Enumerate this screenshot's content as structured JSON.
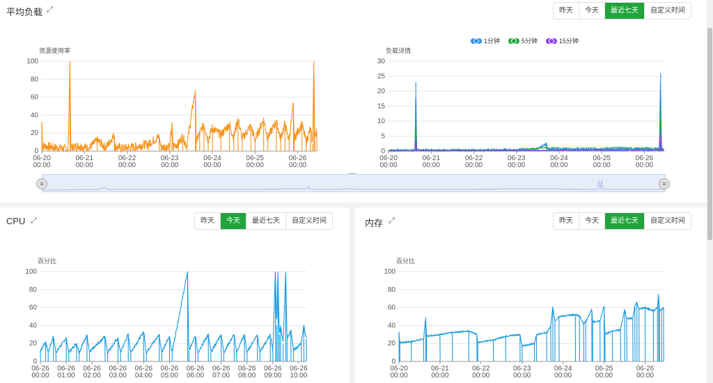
{
  "colors": {
    "active": "#20a53a",
    "load_resource": "#f7941d",
    "load_1min": "#2f8ee6",
    "load_5min": "#1ea83c",
    "load_15min": "#8a3ff0",
    "cpu": "#1a9be0",
    "memory": "#1a9be0",
    "grid": "#e6e6e6",
    "axis": "#999999"
  },
  "load_panel": {
    "title": "平均负载",
    "expand_icon": "expand-icon",
    "buttons": [
      "昨天",
      "今天",
      "最近七天",
      "自定义时间"
    ],
    "active_button": "最近七天"
  },
  "cpu_panel": {
    "title": "CPU",
    "expand_icon": "expand-icon",
    "buttons": [
      "昨天",
      "今天",
      "最近七天",
      "自定义时间"
    ],
    "active_button": "今天"
  },
  "memory_panel": {
    "title": "内存",
    "expand_icon": "expand-icon",
    "buttons": [
      "昨天",
      "今天",
      "最近七天",
      "自定义时间"
    ],
    "active_button": "最近七天"
  },
  "chart_data": [
    {
      "id": "load-usage",
      "type": "line",
      "ylabel": "资源使用率",
      "ylim": [
        0,
        100
      ],
      "yticks": [
        0,
        20,
        40,
        60,
        80,
        100
      ],
      "xticks": [
        "06-20 00:00",
        "06-21 00:00",
        "06-22 00:00",
        "06-23 00:00",
        "06-24 00:00",
        "06-25 00:00",
        "06-26 00:00"
      ],
      "x_range_days": [
        0,
        6.45
      ],
      "series": [
        {
          "points": [
            [
              0,
              33
            ],
            [
              0.02,
              6
            ],
            [
              0.3,
              4
            ],
            [
              0.5,
              3
            ],
            [
              0.62,
              2
            ],
            [
              0.66,
              100
            ],
            [
              0.68,
              4
            ],
            [
              0.9,
              6
            ],
            [
              1.1,
              3
            ],
            [
              1.3,
              12
            ],
            [
              1.5,
              4
            ],
            [
              1.7,
              18
            ],
            [
              1.72,
              5
            ],
            [
              1.9,
              3
            ],
            [
              2.2,
              5
            ],
            [
              2.5,
              8
            ],
            [
              2.75,
              16
            ],
            [
              2.8,
              4
            ],
            [
              3.0,
              6
            ],
            [
              3.05,
              30
            ],
            [
              3.08,
              6
            ],
            [
              3.2,
              8
            ],
            [
              3.3,
              16
            ],
            [
              3.4,
              6
            ],
            [
              3.6,
              68
            ],
            [
              3.62,
              10
            ],
            [
              3.7,
              20
            ],
            [
              3.8,
              30
            ],
            [
              3.9,
              12
            ],
            [
              4.0,
              26
            ],
            [
              4.2,
              18
            ],
            [
              4.4,
              30
            ],
            [
              4.5,
              15
            ],
            [
              4.6,
              36
            ],
            [
              4.7,
              14
            ],
            [
              4.9,
              28
            ],
            [
              5.0,
              12
            ],
            [
              5.2,
              35
            ],
            [
              5.3,
              15
            ],
            [
              5.5,
              33
            ],
            [
              5.6,
              14
            ],
            [
              5.7,
              30
            ],
            [
              5.8,
              12
            ],
            [
              5.9,
              52
            ],
            [
              5.92,
              14
            ],
            [
              6.1,
              30
            ],
            [
              6.2,
              10
            ],
            [
              6.3,
              25
            ],
            [
              6.35,
              8
            ],
            [
              6.38,
              100
            ],
            [
              6.4,
              20
            ],
            [
              6.45,
              22
            ]
          ],
          "baseline_values": [
            5,
            24
          ]
        }
      ]
    },
    {
      "id": "load-detail",
      "type": "line",
      "ylabel": "负载详情",
      "ylim": [
        0,
        30
      ],
      "yticks": [
        0,
        5,
        10,
        15,
        20,
        25,
        30
      ],
      "xticks": [
        "06-20 00:00",
        "06-21 00:00",
        "06-22 00:00",
        "06-23 00:00",
        "06-24 00:00",
        "06-25 00:00",
        "06-26 00:00"
      ],
      "x_range_days": [
        0,
        6.45
      ],
      "series": [
        {
          "name": "1分钟",
          "points": [
            [
              0,
              0.3
            ],
            [
              0.62,
              0.3
            ],
            [
              0.64,
              23
            ],
            [
              0.66,
              0.4
            ],
            [
              1.0,
              0.3
            ],
            [
              2.0,
              0.3
            ],
            [
              3.0,
              0.5
            ],
            [
              3.5,
              0.8
            ],
            [
              3.7,
              2.5
            ],
            [
              3.75,
              0.9
            ],
            [
              4.5,
              0.8
            ],
            [
              5.5,
              1.0
            ],
            [
              6.35,
              0.8
            ],
            [
              6.38,
              26
            ],
            [
              6.4,
              1.0
            ],
            [
              6.45,
              0.8
            ]
          ]
        },
        {
          "name": "5分钟",
          "points": [
            [
              0,
              0.2
            ],
            [
              0.62,
              0.2
            ],
            [
              0.64,
              10
            ],
            [
              0.66,
              0.3
            ],
            [
              3.0,
              0.3
            ],
            [
              3.7,
              1.2
            ],
            [
              3.75,
              0.5
            ],
            [
              6.37,
              0.6
            ],
            [
              6.38,
              15
            ],
            [
              6.4,
              0.6
            ],
            [
              6.45,
              0.5
            ]
          ]
        },
        {
          "name": "15分钟",
          "points": [
            [
              0,
              0.1
            ],
            [
              0.62,
              0.1
            ],
            [
              0.64,
              4
            ],
            [
              0.66,
              0.2
            ],
            [
              3.0,
              0.2
            ],
            [
              6.37,
              0.3
            ],
            [
              6.38,
              6
            ],
            [
              6.4,
              0.3
            ],
            [
              6.45,
              0.3
            ]
          ]
        }
      ]
    },
    {
      "id": "cpu",
      "type": "line",
      "ylabel": "百分比",
      "ylim": [
        0,
        100
      ],
      "yticks": [
        0,
        20,
        40,
        60,
        80,
        100
      ],
      "xticks": [
        "06-26 00:00",
        "06-26 01:00",
        "06-26 02:00",
        "06-26 03:00",
        "06-26 04:00",
        "06-26 05:00",
        "06-26 06:00",
        "06-26 07:00",
        "06-26 08:00",
        "06-26 09:00",
        "06-26 10:00"
      ],
      "x_range_hours": [
        0,
        10.3
      ],
      "series": [
        {
          "points": [
            [
              0,
              12
            ],
            [
              0.2,
              22
            ],
            [
              0.3,
              10
            ],
            [
              0.5,
              28
            ],
            [
              0.6,
              10
            ],
            [
              1.0,
              26
            ],
            [
              1.1,
              10
            ],
            [
              1.4,
              20
            ],
            [
              1.5,
              10
            ],
            [
              1.8,
              30
            ],
            [
              1.9,
              10
            ],
            [
              2.5,
              28
            ],
            [
              2.6,
              10
            ],
            [
              3.0,
              26
            ],
            [
              3.1,
              10
            ],
            [
              3.4,
              30
            ],
            [
              3.5,
              10
            ],
            [
              4.0,
              33
            ],
            [
              4.1,
              10
            ],
            [
              4.6,
              30
            ],
            [
              4.7,
              10
            ],
            [
              5.0,
              28
            ],
            [
              5.1,
              10
            ],
            [
              5.7,
              100
            ],
            [
              5.75,
              12
            ],
            [
              6.0,
              28
            ],
            [
              6.1,
              10
            ],
            [
              6.5,
              30
            ],
            [
              6.6,
              10
            ],
            [
              7.0,
              30
            ],
            [
              7.1,
              10
            ],
            [
              7.5,
              30
            ],
            [
              7.6,
              10
            ],
            [
              7.9,
              30
            ],
            [
              8.0,
              10
            ],
            [
              8.4,
              30
            ],
            [
              8.5,
              10
            ],
            [
              8.9,
              30
            ],
            [
              9.0,
              12
            ],
            [
              9.1,
              100
            ],
            [
              9.15,
              40
            ],
            [
              9.2,
              100
            ],
            [
              9.25,
              30
            ],
            [
              9.3,
              40
            ],
            [
              9.4,
              20
            ],
            [
              9.5,
              100
            ],
            [
              9.55,
              25
            ],
            [
              9.7,
              35
            ],
            [
              9.8,
              12
            ],
            [
              10.1,
              20
            ],
            [
              10.2,
              40
            ],
            [
              10.3,
              25
            ]
          ]
        }
      ]
    },
    {
      "id": "memory",
      "type": "line",
      "ylabel": "百分比",
      "ylim": [
        0,
        100
      ],
      "yticks": [
        0,
        20,
        40,
        60,
        80,
        100
      ],
      "xticks": [
        "06-20 00:00",
        "06-21 00:00",
        "06-22 00:00",
        "06-23 00:00",
        "06-24 00:00",
        "06-25 00:00",
        "06-26 00:00"
      ],
      "x_range_days": [
        0,
        6.45
      ],
      "series": [
        {
          "points": [
            [
              0,
              33
            ],
            [
              0.02,
              21
            ],
            [
              0.3,
              22
            ],
            [
              0.6,
              25
            ],
            [
              0.65,
              49
            ],
            [
              0.67,
              28
            ],
            [
              1.0,
              30
            ],
            [
              1.3,
              32
            ],
            [
              1.7,
              34
            ],
            [
              1.9,
              30
            ],
            [
              1.92,
              21
            ],
            [
              2.3,
              24
            ],
            [
              2.6,
              28
            ],
            [
              2.95,
              30
            ],
            [
              3.0,
              17
            ],
            [
              3.3,
              20
            ],
            [
              3.35,
              30
            ],
            [
              3.6,
              32
            ],
            [
              3.7,
              39
            ],
            [
              3.75,
              61
            ],
            [
              3.8,
              45
            ],
            [
              3.9,
              50
            ],
            [
              4.3,
              52
            ],
            [
              4.4,
              51
            ],
            [
              4.5,
              42
            ],
            [
              4.55,
              44
            ],
            [
              4.7,
              58
            ],
            [
              4.72,
              44
            ],
            [
              4.9,
              45
            ],
            [
              5.0,
              62
            ],
            [
              5.02,
              30
            ],
            [
              5.2,
              34
            ],
            [
              5.4,
              35
            ],
            [
              5.5,
              58
            ],
            [
              5.55,
              48
            ],
            [
              5.7,
              48
            ],
            [
              5.75,
              62
            ],
            [
              5.8,
              66
            ],
            [
              5.85,
              58
            ],
            [
              6.0,
              60
            ],
            [
              6.2,
              56
            ],
            [
              6.3,
              60
            ],
            [
              6.33,
              75
            ],
            [
              6.35,
              56
            ],
            [
              6.4,
              58
            ],
            [
              6.45,
              60
            ]
          ]
        }
      ]
    }
  ]
}
